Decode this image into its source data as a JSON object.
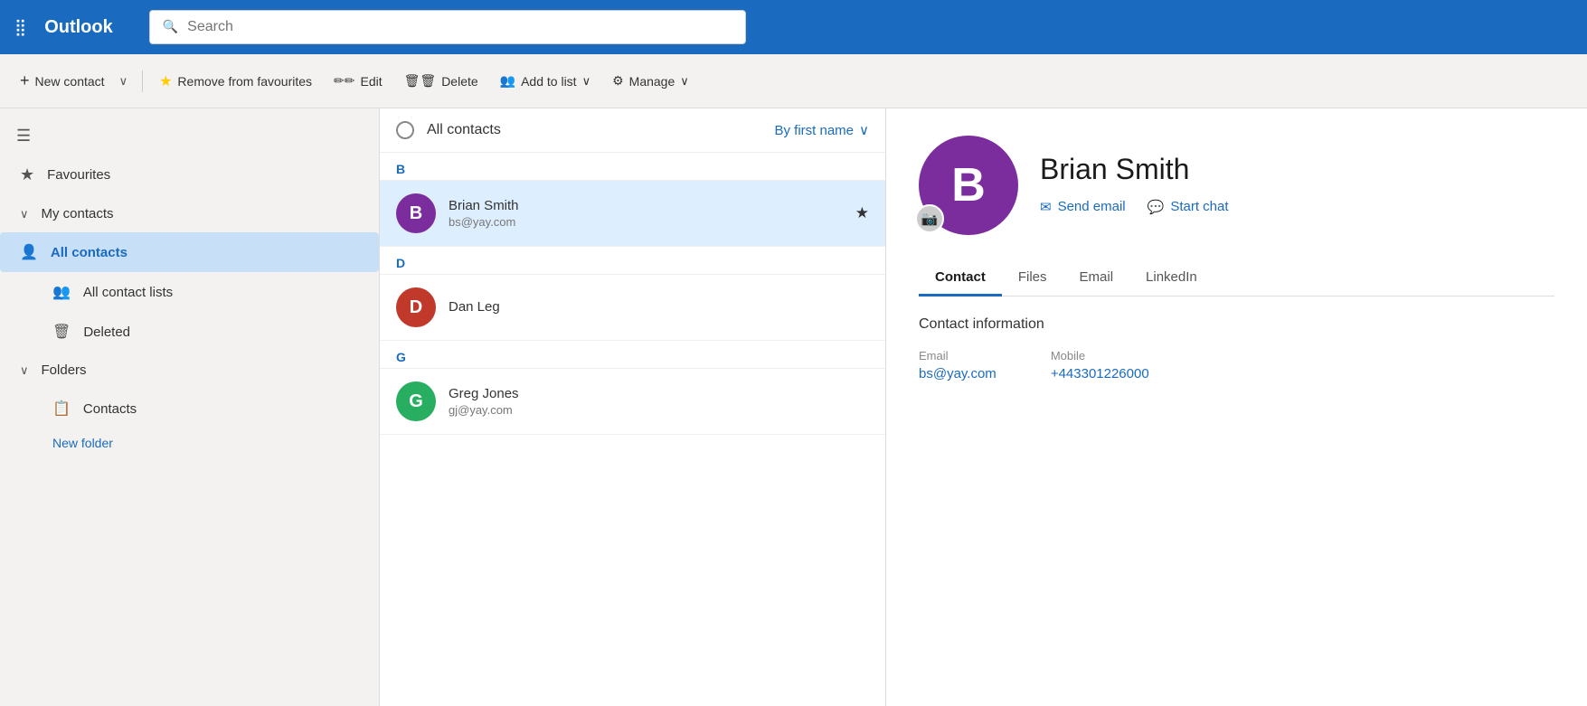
{
  "app": {
    "title": "Outlook",
    "search_placeholder": "Search"
  },
  "toolbar": {
    "new_contact_label": "New contact",
    "remove_fav_label": "Remove from favourites",
    "edit_label": "Edit",
    "delete_label": "Delete",
    "add_to_list_label": "Add to list",
    "manage_label": "Manage"
  },
  "sidebar": {
    "favourites_label": "Favourites",
    "my_contacts_label": "My contacts",
    "all_contacts_label": "All contacts",
    "all_contact_lists_label": "All contact lists",
    "deleted_label": "Deleted",
    "folders_label": "Folders",
    "contacts_label": "Contacts",
    "new_folder_label": "New folder"
  },
  "contact_list": {
    "all_contacts_label": "All contacts",
    "sort_label": "By first name",
    "sections": [
      {
        "letter": "B",
        "contacts": [
          {
            "id": "brian-smith",
            "initials": "B",
            "name": "Brian Smith",
            "email": "bs@yay.com",
            "avatar_color": "#7b2d9e",
            "starred": true,
            "selected": true
          }
        ]
      },
      {
        "letter": "D",
        "contacts": [
          {
            "id": "dan-leg",
            "initials": "D",
            "name": "Dan Leg",
            "email": "",
            "avatar_color": "#c0392b",
            "starred": false,
            "selected": false
          }
        ]
      },
      {
        "letter": "G",
        "contacts": [
          {
            "id": "greg-jones",
            "initials": "G",
            "name": "Greg Jones",
            "email": "gj@yay.com",
            "avatar_color": "#27ae60",
            "starred": false,
            "selected": false
          }
        ]
      }
    ]
  },
  "detail": {
    "contact_name": "Brian Smith",
    "avatar_initials": "B",
    "avatar_color": "#7b2d9e",
    "send_email_label": "Send email",
    "start_chat_label": "Start chat",
    "tabs": [
      "Contact",
      "Files",
      "Email",
      "LinkedIn"
    ],
    "active_tab": "Contact",
    "section_title": "Contact information",
    "fields": {
      "email_label": "Email",
      "email_value": "bs@yay.com",
      "mobile_label": "Mobile",
      "mobile_value": "+443301226000"
    }
  }
}
